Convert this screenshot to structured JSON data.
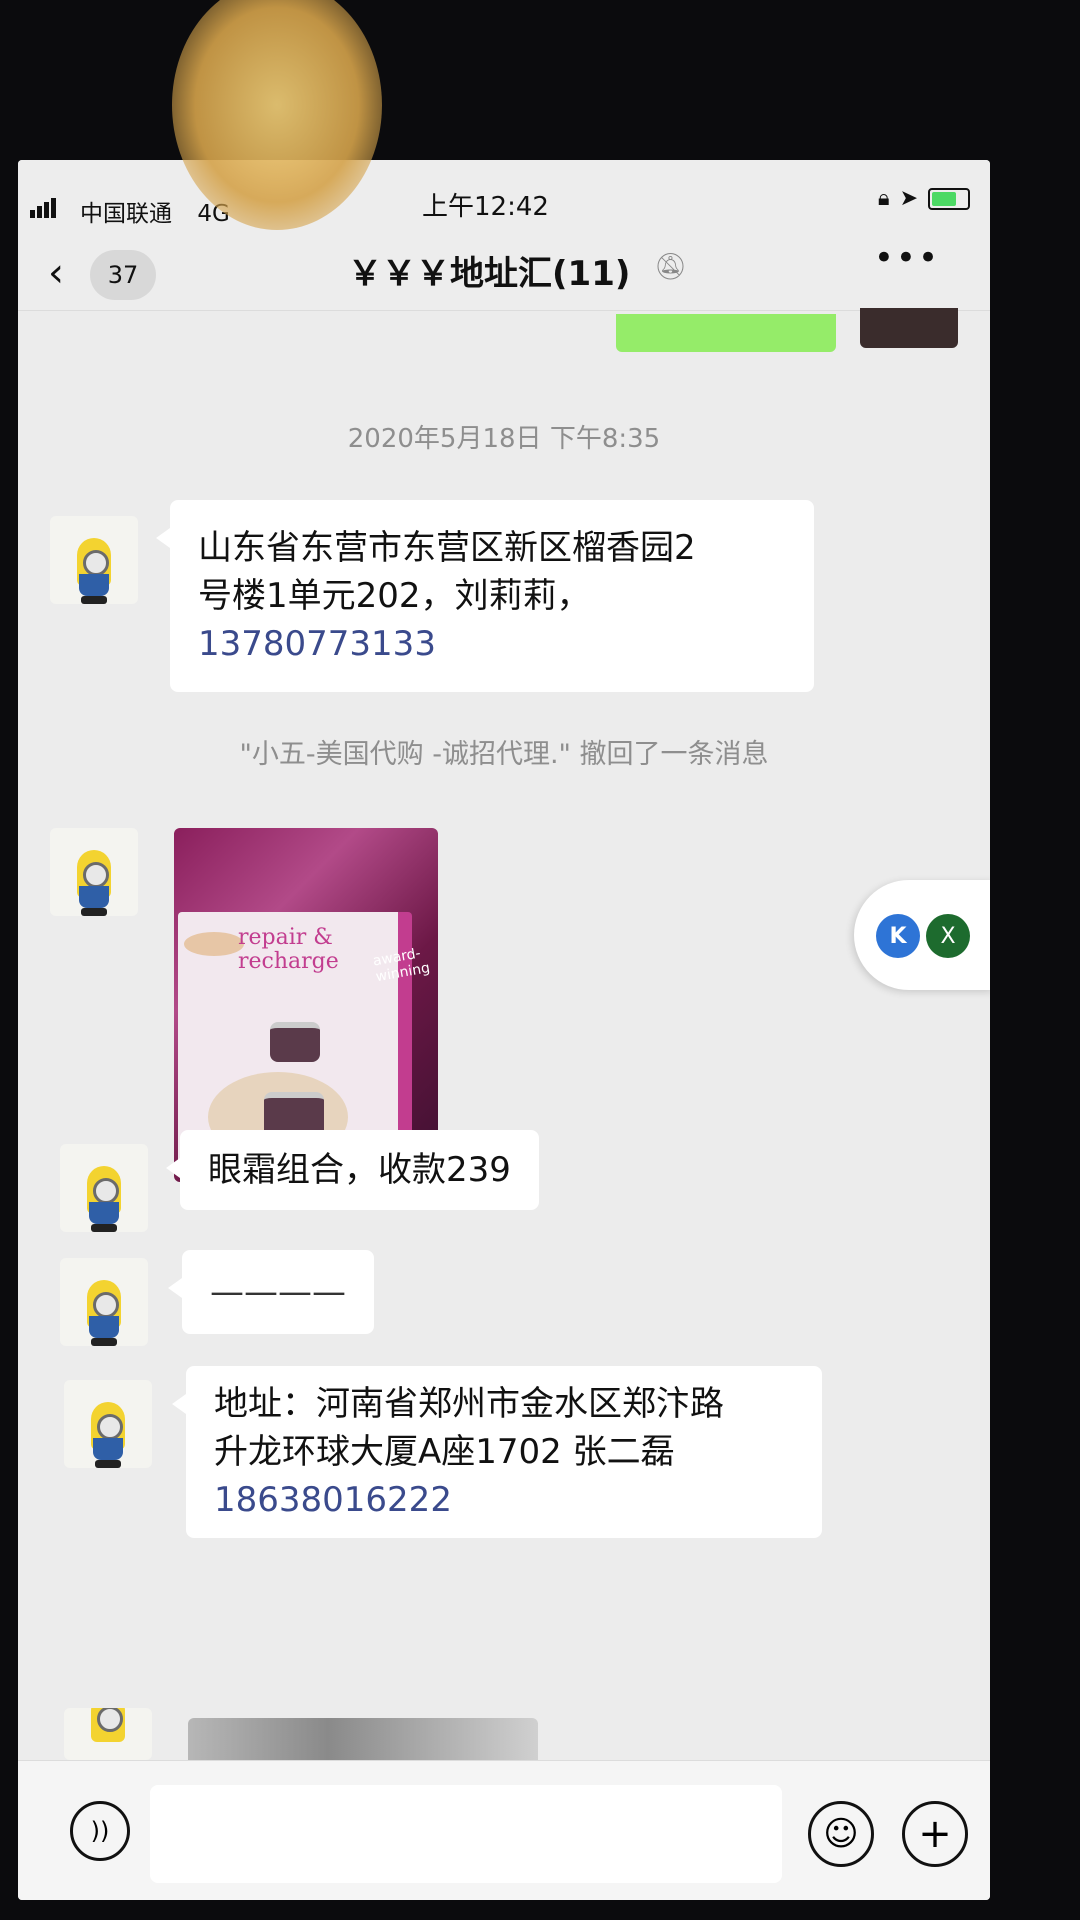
{
  "status_bar": {
    "carrier": "中国联通",
    "network": "4G",
    "time": "上午12:42"
  },
  "nav": {
    "unread_count": "37",
    "title": "￥￥￥地址汇(11)",
    "more": "•••"
  },
  "chat": {
    "timestamp": "2020年5月18日 下午8:35",
    "messages": [
      {
        "text_lines": [
          "山东省东营市东营区新区榴香园2",
          "号楼1单元202，刘莉莉，"
        ],
        "phone": "13780773133"
      },
      {
        "recall_notice": "\"小五-美国代购 -诚招代理.\" 撤回了一条消息"
      },
      {
        "image_text": {
          "brand_line1": "repair &",
          "brand_line2": "recharge",
          "side_text": "award-winning"
        }
      },
      {
        "text": "眼霜组合，收款239"
      },
      {
        "text": "————"
      },
      {
        "text_lines": [
          "地址：河南省郑州市金水区郑汴路",
          "升龙环球大厦A座1702 张二磊"
        ],
        "phone": "18638016222"
      }
    ]
  },
  "floating_widget": {
    "icon1": "K",
    "icon2": "X"
  },
  "input_bar": {
    "placeholder": ""
  },
  "colors": {
    "sent_bubble": "#95ec69",
    "received_bubble": "#ffffff",
    "phone_link": "#3a4a8c",
    "background": "#ececec"
  },
  "icons": [
    "back-icon",
    "mute-icon",
    "more-icon",
    "voice-icon",
    "emoji-icon",
    "plus-icon",
    "battery-icon",
    "location-icon",
    "rotation-lock-icon"
  ]
}
